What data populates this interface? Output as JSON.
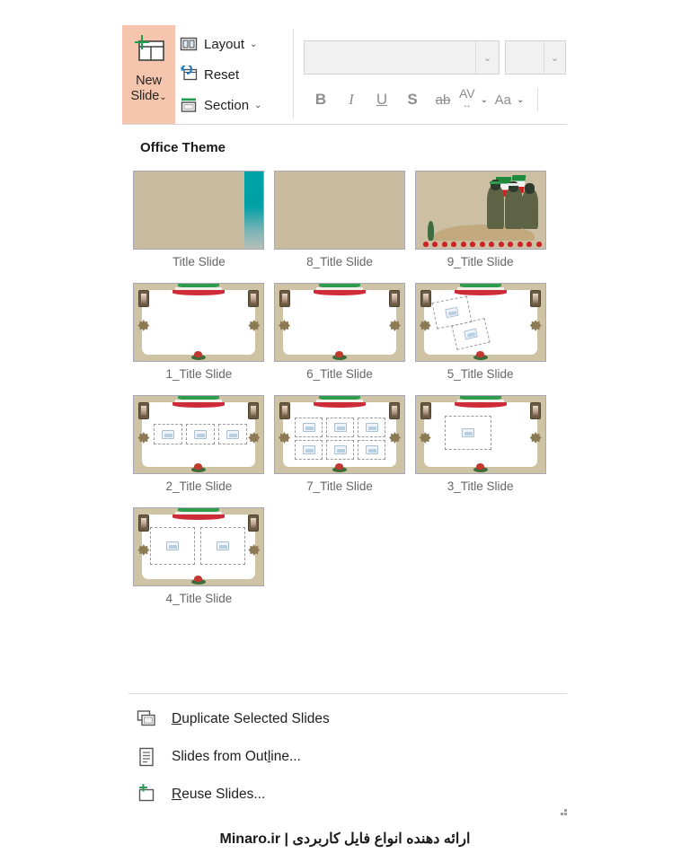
{
  "ribbon": {
    "new_slide": {
      "label_line1": "New",
      "label_line2": "Slide",
      "chevron": "⌄",
      "icon": "new-slide-icon",
      "highlight_color": "#f6c5ad"
    },
    "commands": [
      {
        "label": "Layout",
        "icon": "layout-icon",
        "chevron": "⌄"
      },
      {
        "label": "Reset",
        "icon": "reset-icon",
        "chevron": ""
      },
      {
        "label": "Section",
        "icon": "section-icon",
        "chevron": "⌄"
      }
    ],
    "font_name": {
      "value": "",
      "placeholder": "",
      "chevron": "⌄"
    },
    "font_size": {
      "value": "",
      "placeholder": "",
      "chevron": "⌄"
    },
    "format_buttons": [
      {
        "label": "B",
        "name": "bold-button"
      },
      {
        "label": "I",
        "name": "italic-button"
      },
      {
        "label": "U",
        "name": "underline-button"
      },
      {
        "label": "S",
        "name": "text-shadow-button"
      },
      {
        "label": "ab",
        "name": "strikethrough-button"
      },
      {
        "label": "AV",
        "name": "character-spacing-button",
        "sub": "↔",
        "chevron": "⌄"
      },
      {
        "label": "Aa",
        "name": "change-case-button",
        "chevron": "⌄"
      }
    ]
  },
  "gallery": {
    "title": "Office Theme",
    "rows": [
      [
        {
          "label": "Title Slide",
          "art": "plain-teal"
        },
        {
          "label": "8_Title Slide",
          "art": "plain"
        },
        {
          "label": "9_Title Slide",
          "art": "photo"
        }
      ],
      [
        {
          "label": "1_Title Slide",
          "art": "frame-blank"
        },
        {
          "label": "6_Title Slide",
          "art": "frame-blank"
        },
        {
          "label": "5_Title Slide",
          "art": "frame-rotated2"
        }
      ],
      [
        {
          "label": "2_Title Slide",
          "art": "frame-three"
        },
        {
          "label": "7_Title Slide",
          "art": "frame-six"
        },
        {
          "label": "3_Title Slide",
          "art": "frame-one"
        }
      ],
      [
        {
          "label": "4_Title Slide",
          "art": "frame-two"
        }
      ]
    ]
  },
  "menu": {
    "items": [
      {
        "prefix": "",
        "accel": "D",
        "suffix": "uplicate Selected Slides",
        "icon": "duplicate-slides-icon"
      },
      {
        "prefix": "Slides from Out",
        "accel": "l",
        "suffix": "ine...",
        "icon": "outline-icon"
      },
      {
        "prefix": "",
        "accel": "R",
        "suffix": "euse Slides...",
        "icon": "reuse-slides-icon"
      }
    ]
  },
  "watermark": {
    "text": "ارائه دهنده انواع فایل کاربردی | Minaro.ir"
  }
}
